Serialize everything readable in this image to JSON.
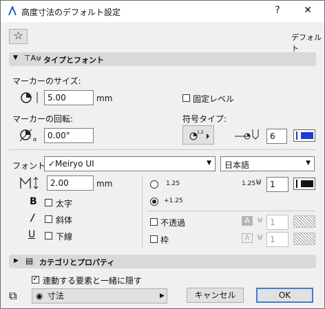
{
  "window": {
    "title": "高度寸法のデフォルト設定",
    "help": "?",
    "close": "✕"
  },
  "toolbar": {
    "default_label": "デフォルト"
  },
  "type_font_section": {
    "title": "タイプとフォント",
    "marker_size_label": "マーカーのサイズ:",
    "marker_size_value": "5.00",
    "marker_size_unit": "mm",
    "fixed_level_label": "固定レベル",
    "marker_rotation_label": "マーカーの回転:",
    "marker_rotation_value": "0.00°",
    "symbol_type_label": "符号タイプ:",
    "pen_value": "6",
    "font_label": "フォント:",
    "font_value": "✓Meiryo UI",
    "language_value": "日本語",
    "text_size_value": "2.00",
    "text_size_unit": "mm",
    "bold_label": "太字",
    "italic_label": "斜体",
    "underline_label": "下線",
    "radio_1_label": "1.25",
    "radio_2_label": "+1.25",
    "right_pen_label": "1.25",
    "right_pen_value": "1",
    "opaque_label": "不透過",
    "opaque_pen_value": "1",
    "frame_label": "枠",
    "frame_pen_value": "1"
  },
  "category_section": {
    "title": "カテゴリとプロパティ"
  },
  "footer": {
    "hide_label": "連動する要素と一緒に隠す",
    "layer_value": "寸法",
    "cancel_label": "キャンセル",
    "ok_label": "OK"
  },
  "colors": {
    "accent": "#3c7fd3",
    "blue_swatch": "#1f3ad8"
  }
}
